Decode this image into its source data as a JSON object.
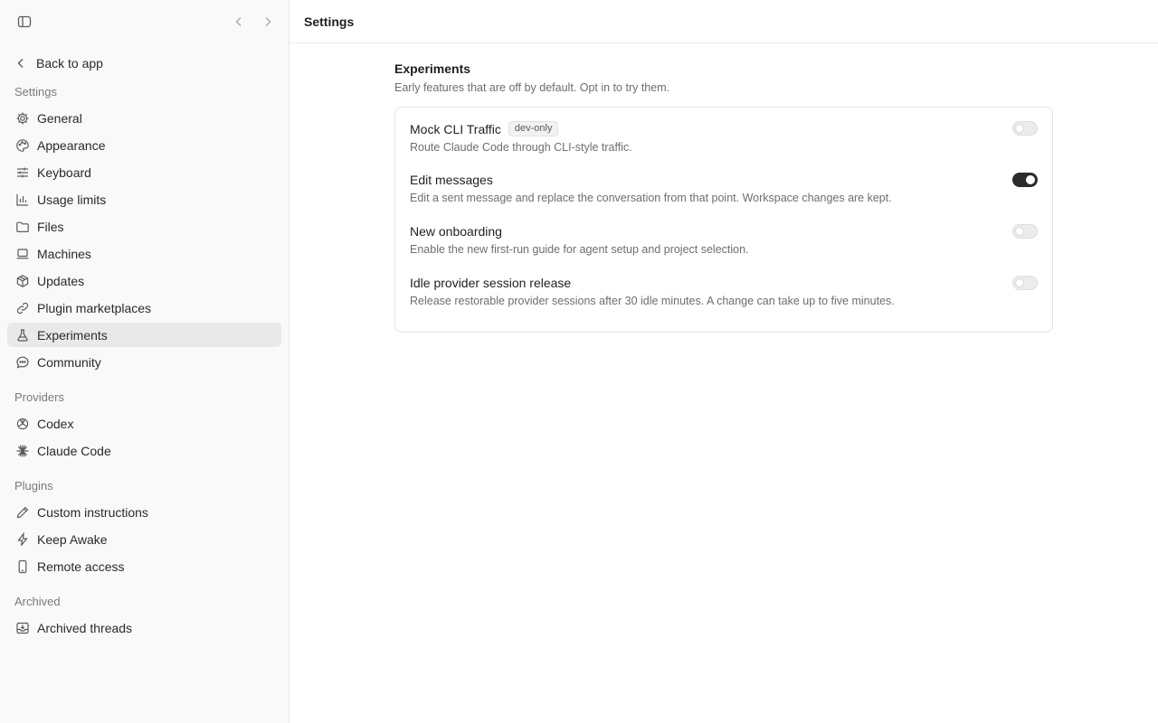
{
  "sidebar": {
    "back_label": "Back to app",
    "sections": {
      "settings": "Settings",
      "providers": "Providers",
      "plugins": "Plugins",
      "archived": "Archived"
    },
    "settings_items": [
      {
        "label": "General",
        "icon": "gear-icon"
      },
      {
        "label": "Appearance",
        "icon": "palette-icon"
      },
      {
        "label": "Keyboard",
        "icon": "sliders-icon"
      },
      {
        "label": "Usage limits",
        "icon": "bar-chart-icon"
      },
      {
        "label": "Files",
        "icon": "folder-icon"
      },
      {
        "label": "Machines",
        "icon": "laptop-icon"
      },
      {
        "label": "Updates",
        "icon": "package-icon"
      },
      {
        "label": "Plugin marketplaces",
        "icon": "link-icon"
      },
      {
        "label": "Experiments",
        "icon": "flask-icon",
        "active": true
      },
      {
        "label": "Community",
        "icon": "chat-bubble-icon"
      }
    ],
    "provider_items": [
      {
        "label": "Codex",
        "icon": "openai-icon"
      },
      {
        "label": "Claude Code",
        "icon": "asterisk-icon"
      }
    ],
    "plugin_items": [
      {
        "label": "Custom instructions",
        "icon": "pencil-icon"
      },
      {
        "label": "Keep Awake",
        "icon": "bolt-icon"
      },
      {
        "label": "Remote access",
        "icon": "phone-icon"
      }
    ],
    "archived_items": [
      {
        "label": "Archived threads",
        "icon": "archive-icon"
      }
    ]
  },
  "header": {
    "title": "Settings"
  },
  "experiments": {
    "title": "Experiments",
    "description": "Early features that are off by default. Opt in to try them.",
    "rows": [
      {
        "title": "Mock CLI Traffic",
        "badge": "dev-only",
        "description": "Route Claude Code through CLI-style traffic.",
        "enabled": false
      },
      {
        "title": "Edit messages",
        "description": "Edit a sent message and replace the conversation from that point. Workspace changes are kept.",
        "enabled": true
      },
      {
        "title": "New onboarding",
        "description": "Enable the new first-run guide for agent setup and project selection.",
        "enabled": false
      },
      {
        "title": "Idle provider session release",
        "description": "Release restorable provider sessions after 30 idle minutes. A change can take up to five minutes.",
        "enabled": false
      }
    ]
  },
  "colors": {
    "active_nav": "#e9e9e9",
    "toggle_on": "#2b2b2b",
    "toggle_off": "#ececec"
  }
}
